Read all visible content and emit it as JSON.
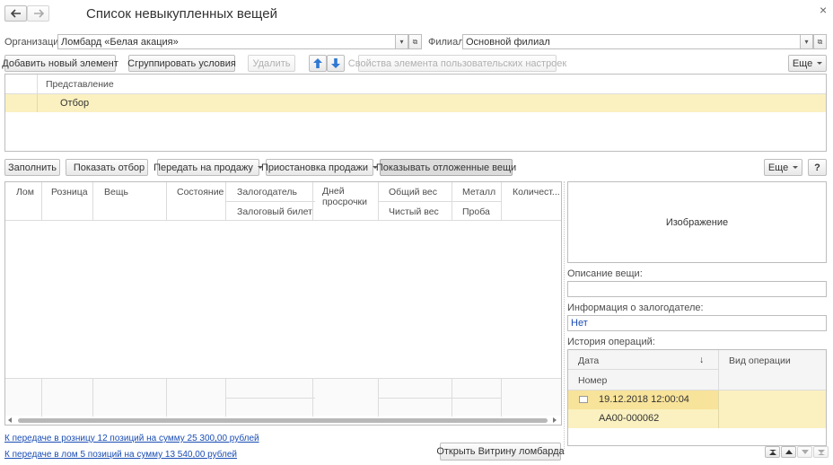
{
  "title": "Список невыкупленных вещей",
  "nav": {
    "back_icon": "arrow-left-icon",
    "forward_icon": "arrow-right-icon",
    "close_glyph": "×"
  },
  "org": {
    "label": "Организация:",
    "value": "Ломбард «Белая акация»"
  },
  "branch": {
    "label": "Филиал:",
    "value": "Основной филиал"
  },
  "settings_toolbar": {
    "add": "Добавить новый элемент",
    "group": "Сгруппировать условия",
    "delete": "Удалить",
    "props": "Свойства элемента пользовательских настроек",
    "more": "Еще"
  },
  "settings_grid": {
    "header": "Представление",
    "row": "Отбор"
  },
  "main_toolbar": {
    "fill": "Заполнить",
    "show_filter": "Показать отбор",
    "transfer": "Передать на продажу",
    "suspend": "Приостановка продажи",
    "show_postponed": "Показывать отложенные вещи",
    "more": "Еще",
    "help": "?"
  },
  "items_grid": {
    "columns": [
      "Лом",
      "Розница",
      "Вещь",
      "Состояние",
      "Залогодатель",
      "Дней просрочки",
      "Общий вес",
      "Металл",
      "Количест..."
    ],
    "subcolumns": {
      "pledger": "Залоговый билет",
      "total_weight": "Чистый вес",
      "metal": "Проба"
    }
  },
  "image_panel": {
    "label": "Изображение"
  },
  "description": {
    "label": "Описание вещи:",
    "value": ""
  },
  "pledger_info": {
    "label": "Информация о залогодателе:",
    "value": "Нет"
  },
  "history": {
    "label": "История операций:",
    "col_date": "Дата",
    "col_number": "Номер",
    "col_op": "Вид операции",
    "sort_glyph": "↓",
    "rows": [
      {
        "date": "19.12.2018 12:00:04",
        "number": "АА00-000062",
        "op": ""
      }
    ]
  },
  "links": {
    "retail": "К передаче в розницу 12 позиций на сумму 25 300,00 рублей",
    "scrap": "К передаче в лом 5 позиций на сумму 13 540,00 рублей"
  },
  "open_showcase": "Открыть Витрину ломбарда",
  "colors": {
    "highlight": "#fbf1c0",
    "highlight_strong": "#f8e39a",
    "link": "#1a4db3",
    "arrow_blue": "#2f79d3"
  }
}
